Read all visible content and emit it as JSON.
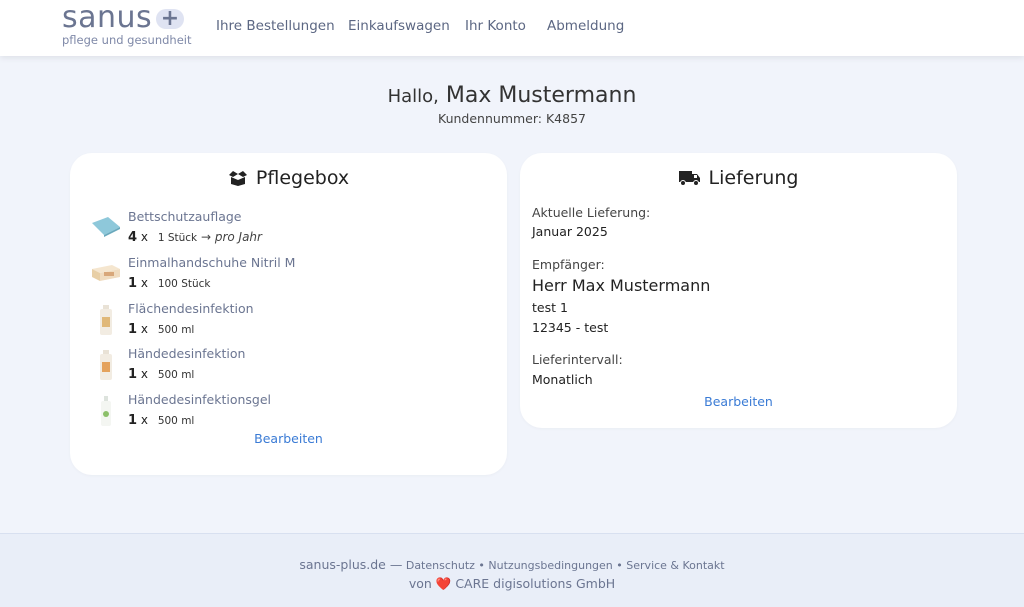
{
  "brand": {
    "name": "sanus",
    "plus": "+",
    "tagline": "pflege und gesundheit"
  },
  "nav": {
    "orders": "Ihre Bestellungen",
    "cart": "Einkaufswagen",
    "account": "Ihr Konto",
    "logout": "Abmeldung"
  },
  "greeting": {
    "hallo": "Hallo,",
    "name": "Max Mustermann",
    "customer_number": "Kundennummer: K4857"
  },
  "pflegebox": {
    "title": "Pflegebox",
    "icon": "box-open-icon",
    "items": [
      {
        "name": "Bettschutzauflage",
        "qty": "4",
        "x": "x",
        "unit": "1 Stück",
        "per": "→ pro Jahr"
      },
      {
        "name": "Einmalhandschuhe Nitril M",
        "qty": "1",
        "x": "x",
        "unit": "100 Stück"
      },
      {
        "name": "Flächendesinfektion",
        "qty": "1",
        "x": "x",
        "unit": "500 ml"
      },
      {
        "name": "Händedesinfektion",
        "qty": "1",
        "x": "x",
        "unit": "500 ml"
      },
      {
        "name": "Händedesinfektionsgel",
        "qty": "1",
        "x": "x",
        "unit": "500 ml"
      }
    ],
    "edit": "Bearbeiten"
  },
  "lieferung": {
    "title": "Lieferung",
    "icon": "truck-icon",
    "current_label": "Aktuelle Lieferung:",
    "current_value": "Januar 2025",
    "recipient_label": "Empfänger:",
    "recipient_name": "Herr Max Mustermann",
    "address_line1": "test 1",
    "address_line2": "12345 - test",
    "interval_label": "Lieferintervall:",
    "interval_value": "Monatlich",
    "edit": "Bearbeiten"
  },
  "footer": {
    "site": "sanus-plus.de —",
    "privacy": "Datenschutz",
    "terms": "Nutzungsbedingungen",
    "service": "Service & Kontakt",
    "sep": "•",
    "by_prefix": "von",
    "heart": "❤️",
    "company": "CARE digisolutions GmbH"
  },
  "colors": {
    "background": "#f1f4fb",
    "link": "#3a7bd5",
    "muted": "#6b7591",
    "heart": "#e0282e"
  }
}
